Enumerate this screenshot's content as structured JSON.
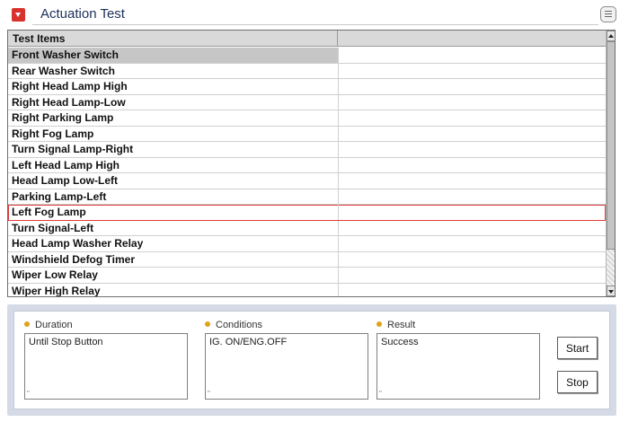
{
  "window": {
    "title": "Actuation Test",
    "title_icon": "dropdown-arrow-icon",
    "menu_icon": "list-menu-icon",
    "accent_color": "#d8322d"
  },
  "grid": {
    "columns": [
      "Test Items",
      ""
    ],
    "selected_row": "Front Washer Switch",
    "highlighted_row": "Left Fog Lamp",
    "highlight_color": "#e03a3a",
    "rows": [
      {
        "item": "Front Washer Switch",
        "value": ""
      },
      {
        "item": "Rear Washer Switch",
        "value": ""
      },
      {
        "item": "Right Head Lamp High",
        "value": ""
      },
      {
        "item": "Right Head Lamp-Low",
        "value": ""
      },
      {
        "item": "Right Parking Lamp",
        "value": ""
      },
      {
        "item": "Right Fog Lamp",
        "value": ""
      },
      {
        "item": "Turn Signal Lamp-Right",
        "value": ""
      },
      {
        "item": "Left Head Lamp High",
        "value": ""
      },
      {
        "item": "Head Lamp Low-Left",
        "value": ""
      },
      {
        "item": "Parking Lamp-Left",
        "value": ""
      },
      {
        "item": "Left Fog Lamp",
        "value": ""
      },
      {
        "item": "Turn Signal-Left",
        "value": ""
      },
      {
        "item": "Head Lamp Washer Relay",
        "value": ""
      },
      {
        "item": "Windshield Defog Timer",
        "value": ""
      },
      {
        "item": "Wiper Low Relay",
        "value": ""
      },
      {
        "item": "Wiper High Relay",
        "value": ""
      }
    ]
  },
  "details": {
    "duration": {
      "label": "Duration",
      "value": "Until Stop Button"
    },
    "conditions": {
      "label": "Conditions",
      "value": "IG. ON/ENG.OFF"
    },
    "result": {
      "label": "Result",
      "value": "Success"
    },
    "bullet_color": "#e0a21a"
  },
  "buttons": {
    "start_label": "Start",
    "stop_label": "Stop"
  }
}
